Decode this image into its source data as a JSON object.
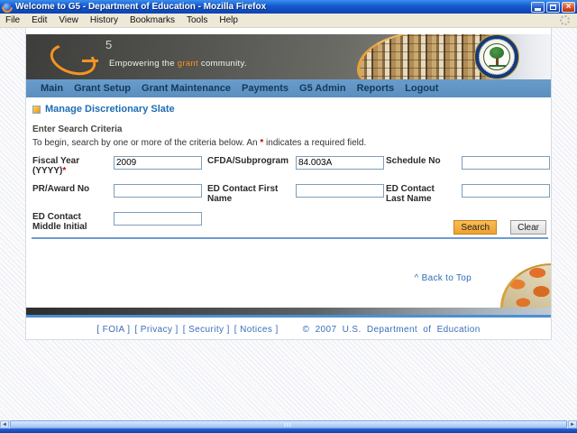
{
  "window": {
    "title": "Welcome to G5 - Department of Education - Mozilla Firefox",
    "close_glyph": "×",
    "menus": [
      "File",
      "Edit",
      "View",
      "History",
      "Bookmarks",
      "Tools",
      "Help"
    ]
  },
  "banner": {
    "five": "5",
    "tagline_pre": "Empowering the ",
    "tagline_highlight": "grant",
    "tagline_post": " community."
  },
  "nav": {
    "items": [
      "Main",
      "Grant Setup",
      "Grant Maintenance",
      "Payments",
      "G5 Admin",
      "Reports",
      "Logout"
    ]
  },
  "page": {
    "title": "Manage Discretionary Slate",
    "section_heading": "Enter Search Criteria",
    "note_pre": "To begin, search by one or more of the criteria below. An ",
    "note_star": "*",
    "note_post": " indicates a required field."
  },
  "form": {
    "fields": [
      {
        "label": "Fiscal Year (YYYY)",
        "star": "*",
        "value": "2009"
      },
      {
        "label": "CFDA/Subprogram",
        "star": "",
        "value": "84.003A"
      },
      {
        "label": "Schedule No",
        "star": "",
        "value": ""
      },
      {
        "label": "PR/Award No",
        "star": "",
        "value": ""
      },
      {
        "label": "ED Contact First Name",
        "star": "",
        "value": ""
      },
      {
        "label": "ED Contact Last Name",
        "star": "",
        "value": ""
      },
      {
        "label": "ED Contact Middle Initial",
        "star": "",
        "value": ""
      }
    ],
    "search_label": "Search",
    "clear_label": "Clear"
  },
  "back_to_top": "^ Back to Top",
  "footer": {
    "links": [
      "[ FOIA ]",
      "[ Privacy ]",
      "[ Security ]",
      "[ Notices ]"
    ],
    "copyright": "© 2007 U.S. Department of Education"
  },
  "scrollbar": {
    "left_arrow": "◄",
    "right_arrow": "►"
  },
  "colors": {
    "accent_orange": "#F7941E",
    "nav_blue": "#5B8FC0",
    "link_blue": "#2F6DB4",
    "required_red": "#CC0000"
  }
}
